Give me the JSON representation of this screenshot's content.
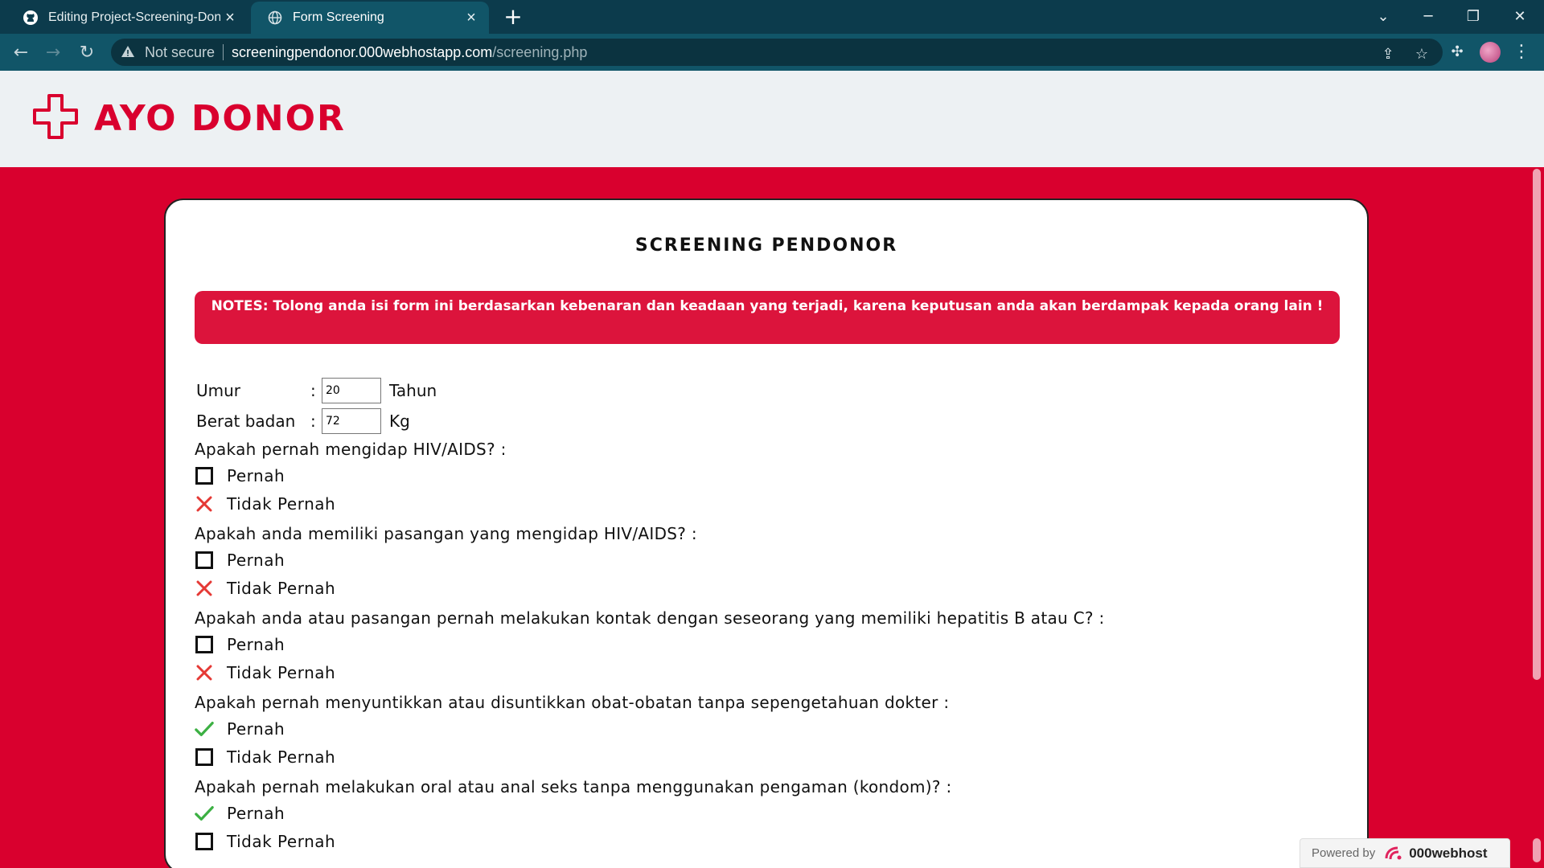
{
  "browser": {
    "tabs": [
      {
        "title": "Editing Project-Screening-Donor",
        "icon": "github-icon",
        "active": false
      },
      {
        "title": "Form Screening",
        "icon": "globe-icon",
        "active": true
      }
    ],
    "new_tab": "+",
    "security_label": "Not secure",
    "url_host": "screeningpendonor.000webhostapp.com",
    "url_path": "/screening.php"
  },
  "site": {
    "logo_text": "AYO DONOR",
    "brand_color": "#d9002e"
  },
  "form": {
    "title": "SCREENING PENDONOR",
    "notes": "NOTES: Tolong anda isi form ini berdasarkan kebenaran dan keadaan yang terjadi, karena keputusan anda akan berdampak kepada orang lain !",
    "age_label": "Umur",
    "age_value": "20",
    "age_unit": "Tahun",
    "weight_label": "Berat badan",
    "weight_value": "72",
    "weight_unit": "Kg",
    "colon": ":",
    "questions": [
      {
        "text": "Apakah pernah mengidap HIV/AIDS? :",
        "options": [
          {
            "label": "Pernah",
            "state": "empty"
          },
          {
            "label": "Tidak Pernah",
            "state": "cross"
          }
        ]
      },
      {
        "text": "Apakah anda memiliki pasangan yang mengidap HIV/AIDS? :",
        "options": [
          {
            "label": "Pernah",
            "state": "empty"
          },
          {
            "label": "Tidak Pernah",
            "state": "cross"
          }
        ]
      },
      {
        "text": "Apakah anda atau pasangan pernah melakukan kontak dengan seseorang yang memiliki hepatitis B atau C? :",
        "options": [
          {
            "label": "Pernah",
            "state": "empty"
          },
          {
            "label": "Tidak Pernah",
            "state": "cross"
          }
        ]
      },
      {
        "text": "Apakah pernah menyuntikkan atau disuntikkan obat-obatan tanpa sepengetahuan dokter :",
        "options": [
          {
            "label": "Pernah",
            "state": "check"
          },
          {
            "label": "Tidak Pernah",
            "state": "empty"
          }
        ]
      },
      {
        "text": "Apakah pernah melakukan oral atau anal seks tanpa menggunakan pengaman (kondom)? :",
        "options": [
          {
            "label": "Pernah",
            "state": "check"
          },
          {
            "label": "Tidak Pernah",
            "state": "empty"
          }
        ]
      }
    ]
  },
  "footer_badge": {
    "prefix": "Powered by",
    "brand": "000webhost"
  }
}
